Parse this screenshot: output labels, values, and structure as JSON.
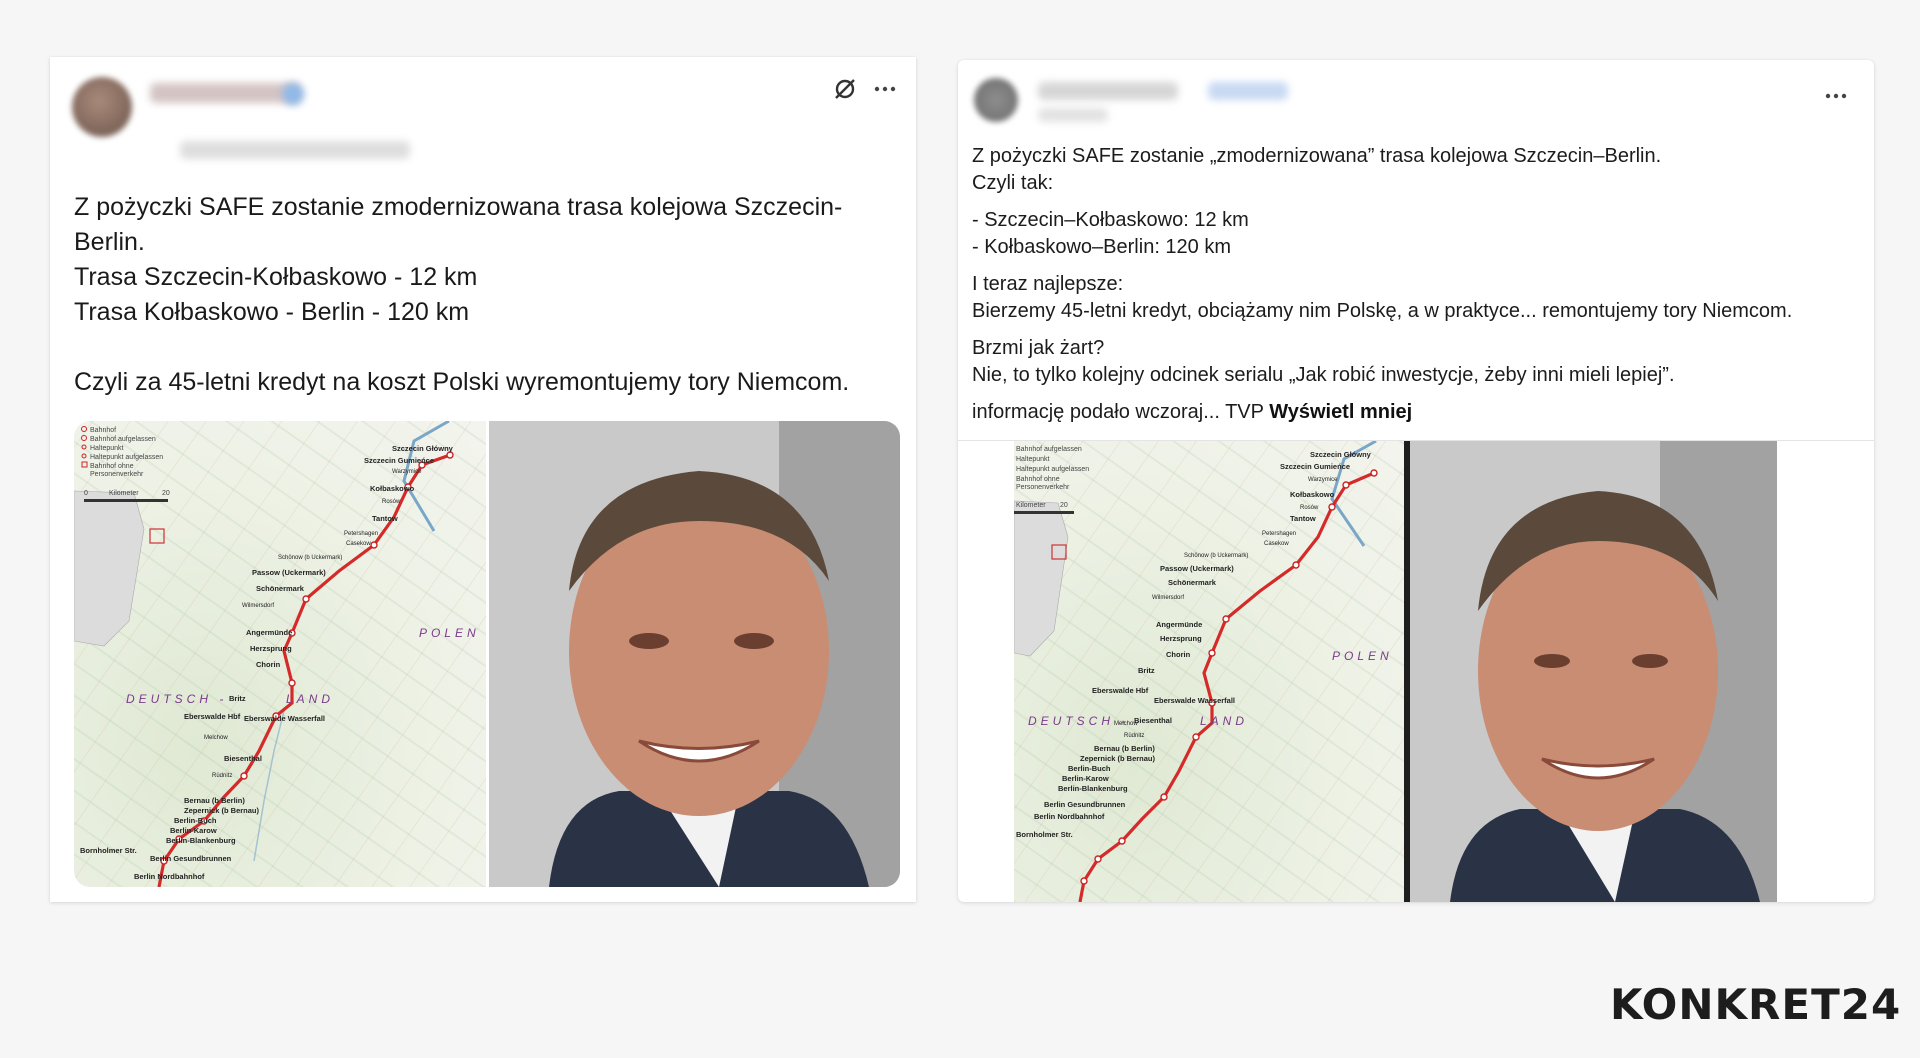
{
  "left_post": {
    "text": {
      "line1": "Z pożyczki SAFE zostanie zmodernizowana trasa kolejowa Szczecin-Berlin.",
      "line2": "Trasa Szczecin-Kołbaskowo - 12 km",
      "line3": "Trasa Kołbaskowo - Berlin - 120 km",
      "line4": "Czyli za 45-letni kredyt na koszt Polski wyremontujemy tory Niemcom."
    },
    "icons": {
      "grok": "grok-icon",
      "more": "more-options-icon"
    }
  },
  "right_post": {
    "text": {
      "p1a": "Z pożyczki SAFE zostanie „zmodernizowana” trasa kolejowa Szczecin–Berlin.",
      "p1b": "Czyli tak:",
      "p2a": "- Szczecin–Kołbaskowo: 12 km",
      "p2b": "- Kołbaskowo–Berlin: 120 km",
      "p3a": "I teraz najlepsze:",
      "p3b": "Bierzemy 45-letni kredyt, obciążamy nim Polskę, a w praktyce... remontujemy tory Niemcom.",
      "p4a": "Brzmi jak żart?",
      "p4b": "Nie, to tylko kolejny odcinek serialu „Jak robić inwestycje, żeby inni mieli lepiej”.",
      "p5": "informację podało wczoraj... TVP",
      "see_less": "Wyświetl mniej"
    },
    "icons": {
      "more": "more-options-icon"
    }
  },
  "map": {
    "legend": [
      "Bahnhof",
      "Bahnhof aufgelassen",
      "Haltepunkt",
      "Haltepunkt aufgelassen",
      "Bahnhof ohne",
      "Personenverkehr"
    ],
    "scale_label": "Kilometer",
    "scale_min": "0",
    "scale_max": "20",
    "region_polen": "POLEN",
    "region_deutschland_a": "DEUTSCH -",
    "region_deutschland_b": "LAND",
    "stations": [
      "Szczecin Główny",
      "Szczecin Gumieńce",
      "Warzymice",
      "Kołbaskowo",
      "Rosów",
      "Tantow",
      "Petershagen",
      "Casekow",
      "Schönow (b Uckermark)",
      "Passow (Uckermark)",
      "Schönermark",
      "Wilmersdorf",
      "Angermünde",
      "Herzsprung",
      "Chorin",
      "Britz",
      "Eberswalde Hbf",
      "Eberswalde Wasserfall",
      "Melchow",
      "Biesenthal",
      "Rüdnitz",
      "Bernau (b Berlin)",
      "Zepernick (b Bernau)",
      "Berlin-Buch",
      "Berlin-Karow",
      "Berlin-Blankenburg",
      "Berlin Gesundbrunnen",
      "Bornholmer Str.",
      "Berlin Nordbahnhof"
    ]
  },
  "branding": {
    "logo": "KONKRET24"
  }
}
